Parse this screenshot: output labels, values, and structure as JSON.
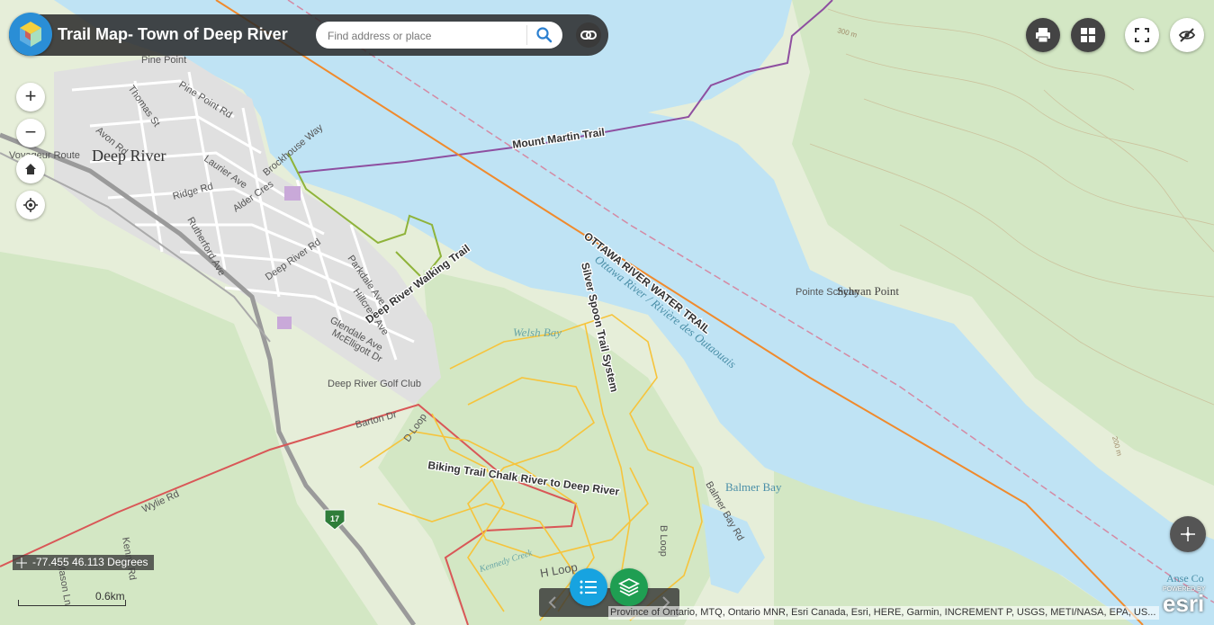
{
  "header": {
    "title": "Trail Map- Town of Deep River",
    "search_placeholder": "Find address or place"
  },
  "toolbar": {
    "print_icon": "printer-icon",
    "gallery_icon": "grid-icon",
    "fullscreen_icon": "fullscreen-icon",
    "visibility_icon": "eye-slash-icon"
  },
  "map_controls": {
    "zoom_in": "+",
    "zoom_out": "−"
  },
  "map_labels": {
    "town": "Deep River",
    "pine_point": "Pine Point",
    "voyageur_route": "Voyageur Route",
    "thomas_st": "Thomas St",
    "pine_point_rd": "Pine Point Rd",
    "avon_rd": "Avon Rd",
    "laurier_ave": "Laurier Ave",
    "brockhouse_way": "Brockhouse Way",
    "alder_cres": "Alder Cres",
    "ridge_rd": "Ridge Rd",
    "rutherford_ave": "Rutherford Ave",
    "deep_river_rd": "Deep River Rd",
    "parkdale_ave": "Parkdale Ave",
    "hillcrest_ave": "Hillcrest Ave",
    "glendale_ave": "Glendale Ave",
    "mcelligott_dr": "McElligott Dr",
    "golf_club": "Deep River Golf Club",
    "barton_dr": "Barton Dr",
    "d_loop": "D Loop",
    "wylie_rd": "Wylie Rd",
    "kenny_rd": "Kenny Rd",
    "mason_ln": "Mason Ln",
    "highway_17": "17",
    "welsh_bay": "Welsh Bay",
    "balmer_bay": "Balmer Bay",
    "balmer_bay_rd": "Balmer Bay Rd",
    "b_loop": "B Loop",
    "h_loop": "H Loop",
    "kennedy_creek": "Kennedy Creek",
    "pointe_schyan": "Pointe Schyan",
    "schyan_point": "Schyan Point",
    "ottawa_river": "Ottawa River / Rivière des Outaouais",
    "anse": "Anse Co",
    "contour_300": "300 m",
    "contour_200": "200 m"
  },
  "trails": {
    "mount_martin": "Mount Martin Trail",
    "ottawa_water": "OTTAWA RIVER WATER TRAIL",
    "silver_spoon": "Silver Spoon Trail System",
    "deep_river_walking": "Deep River Walking Trail",
    "biking_trail": "Biking Trail Chalk River to Deep River"
  },
  "colors": {
    "water": "#bfe3f4",
    "land": "#e7efd9",
    "forest": "#cfe6c0",
    "mount_martin_trail": "#8e4fa0",
    "water_trail": "#f08a2c",
    "walking_trail": "#8fb33a",
    "biking_trail": "#d95757",
    "silver_spoon_trail": "#f6c43c"
  },
  "footer": {
    "coordinates": "-77.455 46.113 Degrees",
    "scale": "0.6km",
    "attribution": "Province of Ontario, MTQ, Ontario MNR, Esri Canada, Esri, HERE, Garmin, INCREMENT P, USGS, METI/NASA, EPA, US...",
    "esri_powered": "POWERED BY",
    "esri_logo": "esri"
  }
}
